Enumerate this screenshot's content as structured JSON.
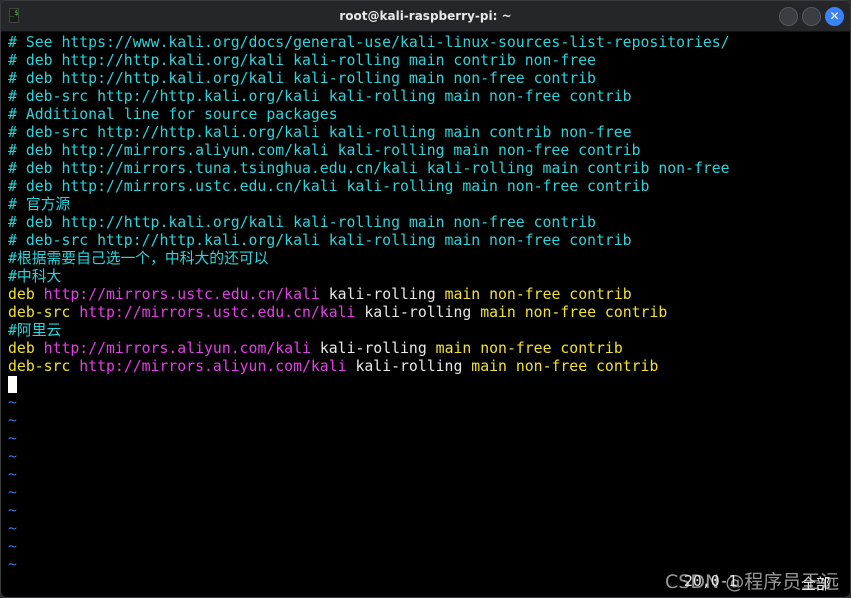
{
  "window": {
    "title": "root@kali-raspberry-pi: ~",
    "close_label": "✕"
  },
  "comment_lines": [
    "# See https://www.kali.org/docs/general-use/kali-linux-sources-list-repositories/",
    "# deb http://http.kali.org/kali kali-rolling main contrib non-free",
    "# deb http://http.kali.org/kali kali-rolling main non-free contrib",
    "# deb-src http://http.kali.org/kali kali-rolling main non-free contrib",
    "# Additional line for source packages",
    "# deb-src http://http.kali.org/kali kali-rolling main contrib non-free",
    "# deb http://mirrors.aliyun.com/kali kali-rolling main non-free contrib",
    "# deb http://mirrors.tuna.tsinghua.edu.cn/kali kali-rolling main contrib non-free",
    "# deb http://mirrors.ustc.edu.cn/kali kali-rolling main non-free contrib",
    "# 官方源",
    "# deb http://http.kali.org/kali kali-rolling main non-free contrib",
    "# deb-src http://http.kali.org/kali kali-rolling main non-free contrib",
    "#根据需要自己选一个，中科大的还可以",
    "#中科大"
  ],
  "ustc": [
    {
      "type": "deb",
      "url": "http://mirrors.ustc.edu.cn/kali",
      "dist": "kali-rolling",
      "components": "main non-free contrib"
    },
    {
      "type": "deb-src",
      "url": "http://mirrors.ustc.edu.cn/kali",
      "dist": "kali-rolling",
      "components": "main non-free contrib"
    }
  ],
  "aliyun_comment": "#阿里云",
  "aliyun": [
    {
      "type": "deb",
      "url": "http://mirrors.aliyun.com/kali",
      "dist": "kali-rolling",
      "components": "main non-free contrib"
    },
    {
      "type": "deb-src",
      "url": "http://mirrors.aliyun.com/kali",
      "dist": "kali-rolling",
      "components": "main non-free contrib"
    }
  ],
  "tilde": "~",
  "status": {
    "position": "20,0-1",
    "scroll": "全部"
  },
  "watermark": "CSDN @程序员王远",
  "colors": {
    "comment": "#2ad4dc",
    "keyword": "#f2e22a",
    "url": "#e53ee8",
    "tilde": "#3f6fd8"
  }
}
